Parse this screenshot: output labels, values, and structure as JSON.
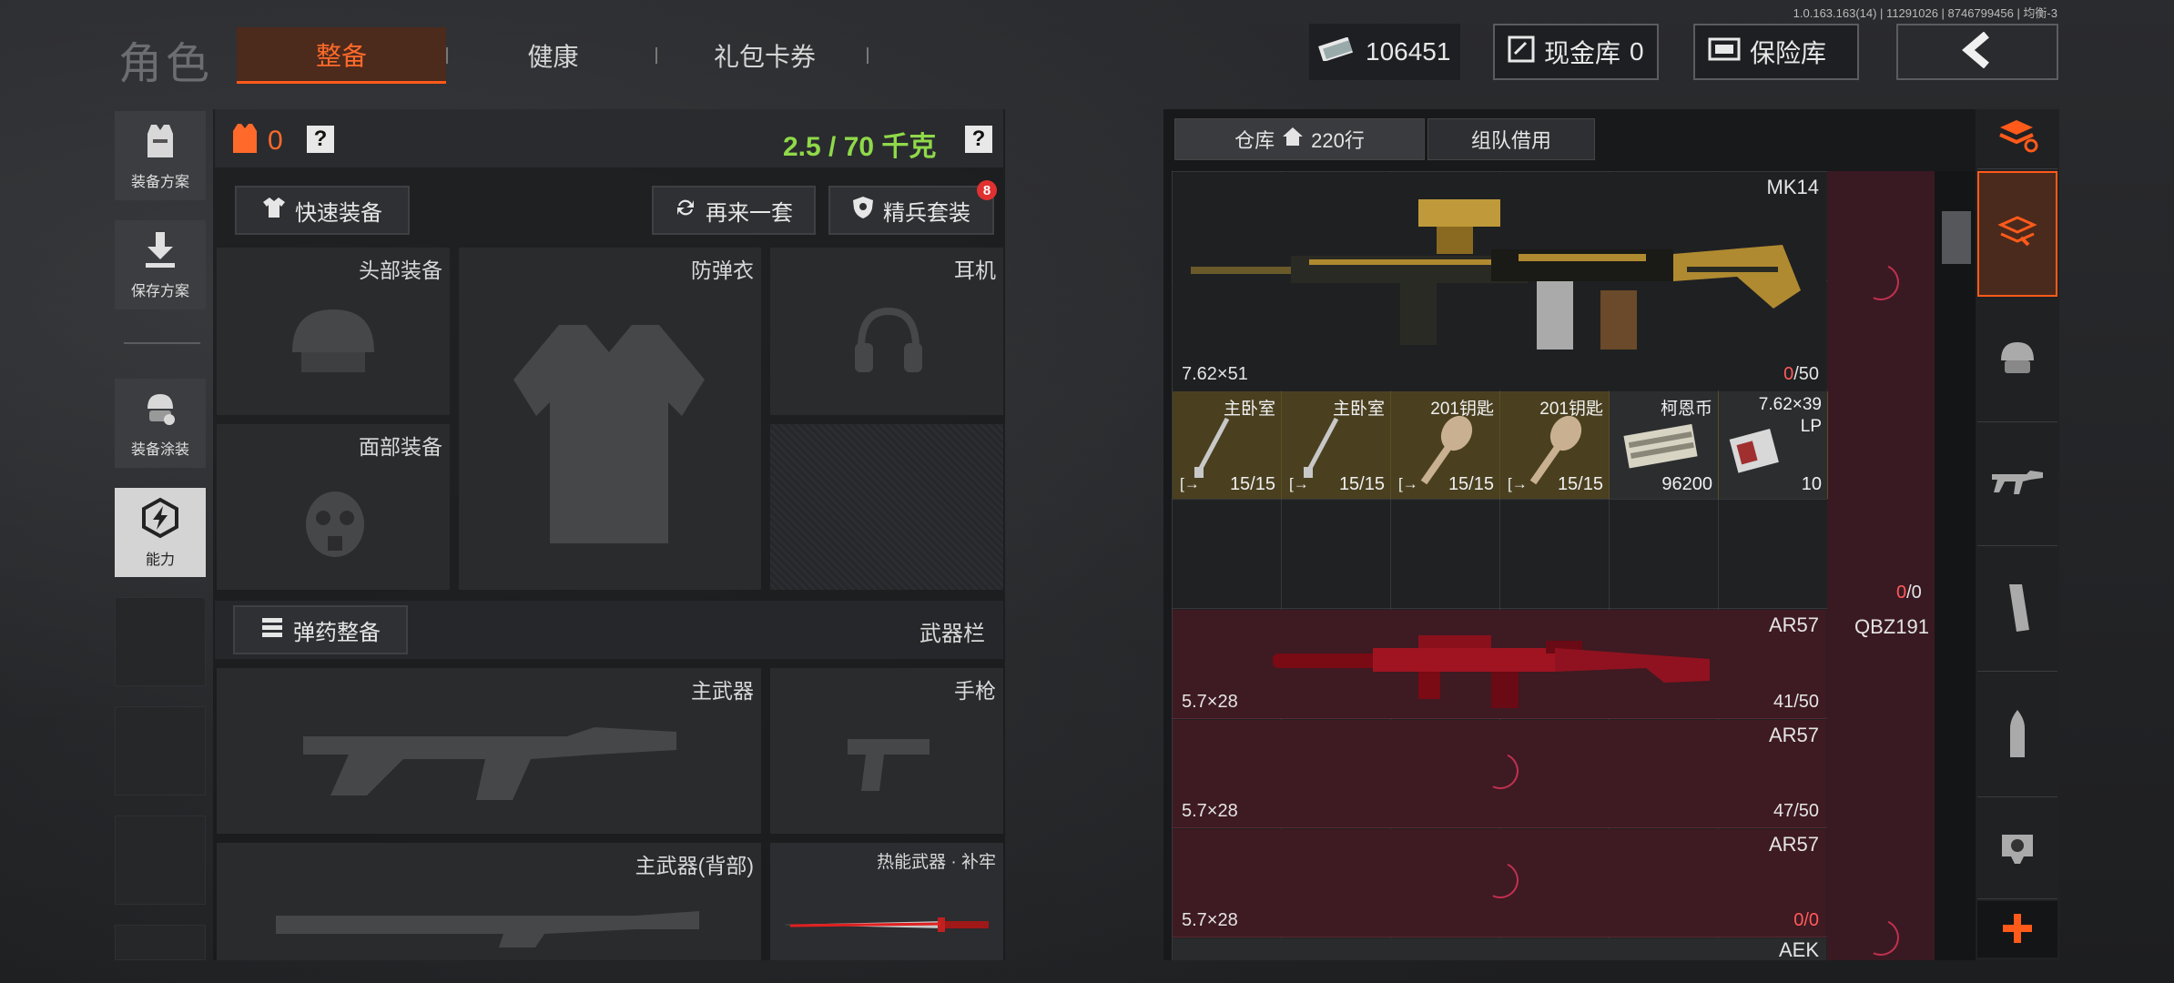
{
  "version": "1.0.163.163(14) | 11291026 | 8746799456 | 均衡-3",
  "page_title": "角色",
  "tabs": [
    {
      "label": "整备",
      "active": true
    },
    {
      "label": "健康",
      "active": false
    },
    {
      "label": "礼包卡券",
      "active": false
    }
  ],
  "currency": {
    "amount": "106451"
  },
  "cash_vault": {
    "label": "现金库",
    "value": "0"
  },
  "insurance": {
    "label": "保险库"
  },
  "sidebar": [
    {
      "label": "装备方案",
      "icon": "vest-icon"
    },
    {
      "label": "保存方案",
      "icon": "download-icon"
    },
    {
      "label": "装备涂装",
      "icon": "helmet-paint-icon"
    },
    {
      "label": "能力",
      "icon": "lightning-hex-icon"
    }
  ],
  "loadout": {
    "armor_count": "0",
    "help": "?",
    "weight": "2.5 / 70 千克",
    "quick_equip": "快速装备",
    "reroll": "再来一套",
    "elite_set": "精兵套装",
    "elite_badge": "8",
    "slots": {
      "head": "头部装备",
      "vest": "防弹衣",
      "headset": "耳机",
      "face": "面部装备",
      "primary": "主武器",
      "pistol": "手枪",
      "primary_back": "主武器(背部)",
      "melee": "热能武器 · 补牢"
    },
    "ammo_button": "弹药整备",
    "weapon_bar": "武器栏"
  },
  "warehouse": {
    "tab_storage": "仓库",
    "tab_rows": "220行",
    "tab_team": "组队借用",
    "items": [
      {
        "name": "MK14",
        "caliber": "7.62×51",
        "dur_cur": "0",
        "dur_max": "/50"
      },
      {
        "name": "AR57",
        "caliber": "5.7×28",
        "dur_cur": "41",
        "dur_max": "/50"
      },
      {
        "name": "AR57",
        "caliber": "5.7×28",
        "dur_cur": "47",
        "dur_max": "/50"
      },
      {
        "name": "AR57",
        "caliber": "5.7×28",
        "dur_cur": "0",
        "dur_max": "/0"
      },
      {
        "name": "AEK"
      }
    ],
    "small_items": [
      {
        "name": "主卧室",
        "count": "15/15"
      },
      {
        "name": "主卧室",
        "count": "15/15"
      },
      {
        "name": "201钥匙",
        "count": "15/15"
      },
      {
        "name": "201钥匙",
        "count": "15/15"
      },
      {
        "name": "柯恩币",
        "count": "96200"
      },
      {
        "name": "7.62×39",
        "sub": "LP",
        "count": "10"
      }
    ],
    "empty_dur": {
      "cur": "0",
      "max": "/0"
    },
    "side_item": "QBZ191"
  },
  "colors": {
    "accent": "#ff5a1a",
    "weight_ok": "#8fd94a",
    "danger": "#ff5a5a"
  }
}
